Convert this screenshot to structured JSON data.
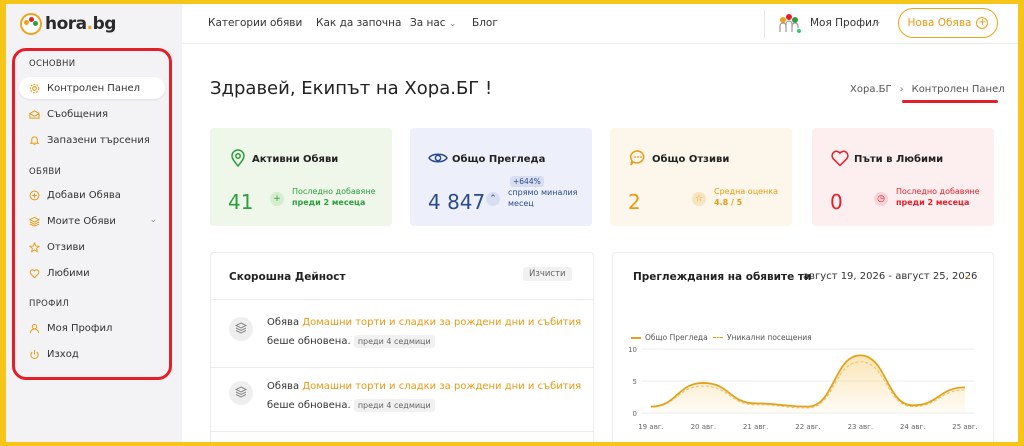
{
  "logo": {
    "text_main": "hora",
    "text_dot": ".",
    "text_tld": "bg"
  },
  "sidebar": {
    "sections": [
      {
        "title": "ОСНОВНИ",
        "items": [
          {
            "label": "Контролен Панел",
            "icon": "gear-icon",
            "active": true
          },
          {
            "label": "Съобщения",
            "icon": "envelope-icon"
          },
          {
            "label": "Запазени търсения",
            "icon": "bell-icon"
          }
        ]
      },
      {
        "title": "ОБЯВИ",
        "items": [
          {
            "label": "Добави Обява",
            "icon": "plus-circle-icon"
          },
          {
            "label": "Моите Обяви",
            "icon": "layers-icon",
            "has_submenu": true
          },
          {
            "label": "Отзиви",
            "icon": "star-icon"
          },
          {
            "label": "Любими",
            "icon": "heart-icon"
          }
        ]
      },
      {
        "title": "ПРОФИЛ",
        "items": [
          {
            "label": "Моя Профил",
            "icon": "user-icon"
          },
          {
            "label": "Изход",
            "icon": "power-icon"
          }
        ]
      }
    ]
  },
  "topnav": {
    "items": [
      "Категории обяви",
      "Как да започна",
      "За нас",
      "Блог"
    ],
    "profile_name": "Моя Профил",
    "new_button": "Нова Обява"
  },
  "greeting": "Здравей, Екипът на Хора.БГ !",
  "breadcrumb": {
    "home": "Хора.БГ",
    "current": "Контролен Панел"
  },
  "stats": [
    {
      "title": "Активни Обяви",
      "value": "41",
      "note_line1": "Последно добавяне",
      "note_line2": "преди 2 месеца",
      "icon": "map-pin-icon",
      "color": "#2e9e3e",
      "bg": "#eef7ea"
    },
    {
      "title": "Общо Прегледа",
      "value": "4 847",
      "badge": "+644%",
      "note_line1": "спрямо миналия",
      "note_line2": "месец",
      "icon": "eye-icon",
      "color": "#2c4a8a",
      "bg": "#edf0fa"
    },
    {
      "title": "Общо Отзиви",
      "value": "2",
      "note_line1": "Средна оценка",
      "note_line2": "4.8 / 5",
      "icon": "chat-icon",
      "color": "#e89a12",
      "bg": "#fdf6ea"
    },
    {
      "title": "Пъти в Любими",
      "value": "0",
      "note_line1": "Последно добавяне",
      "note_line2": "преди 2 месеца",
      "icon": "heart-icon",
      "color": "#e3202a",
      "bg": "#fdeef0"
    }
  ],
  "activity": {
    "title": "Скорошна Дейност",
    "clear_label": "Изчисти",
    "items": [
      {
        "prefix": "Обява",
        "link": "Домашни торти и сладки за рождени дни и събития",
        "suffix": "беше обновена.",
        "ago": "преди 4 седмици"
      },
      {
        "prefix": "Обява",
        "link": "Домашни торти и сладки за рождени дни и събития",
        "suffix": "беше обновена.",
        "ago": "преди 4 седмици"
      }
    ]
  },
  "views_panel": {
    "title": "Преглеждания на обявите ти",
    "range": "август 19, 2026 - август 25, 2026"
  },
  "chart_data": {
    "type": "line",
    "categories": [
      "19 авг.",
      "20 авг.",
      "21 авг.",
      "22 авг.",
      "23 авг.",
      "24 авг.",
      "25 авг."
    ],
    "series": [
      {
        "name": "Общо Прегледа",
        "values": [
          1,
          4.7,
          1.5,
          1,
          9,
          1.2,
          4
        ]
      },
      {
        "name": "Уникални посещения",
        "values": [
          1,
          4.2,
          1.3,
          0.8,
          8,
          1,
          3.6
        ]
      }
    ],
    "yticks": [
      "0",
      "5",
      "10"
    ],
    "ylim": [
      0,
      10
    ],
    "colors": [
      "#e3a21a",
      "#f0c470"
    ],
    "grid": true,
    "legend": "top-left"
  }
}
